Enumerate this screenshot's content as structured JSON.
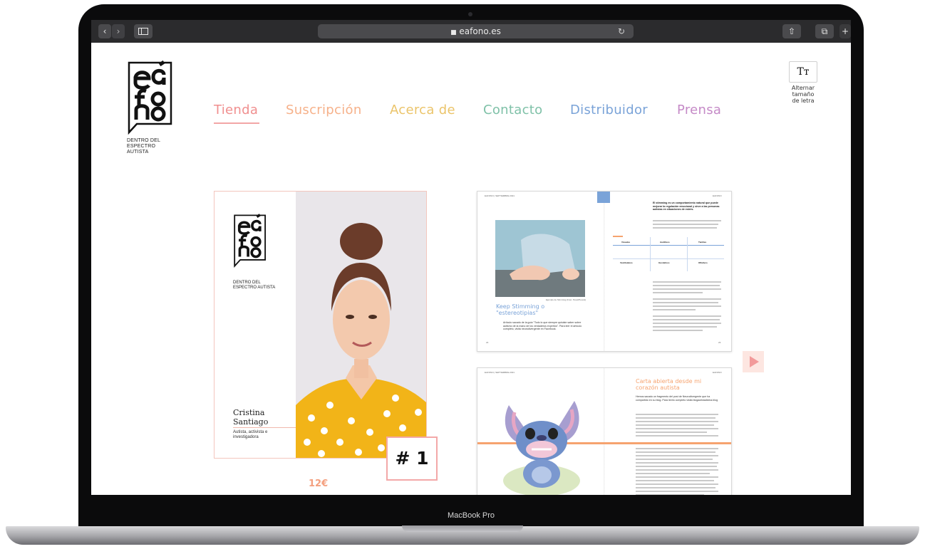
{
  "browser": {
    "url": "eafono.es",
    "back_glyph": "‹",
    "forward_glyph": "›",
    "reload_glyph": "↻",
    "share_glyph": "⇧",
    "tabs_glyph": "⧉",
    "newtab_glyph": "+"
  },
  "logo": {
    "subtitle": "DENTRO DEL ESPECTRO AUTISTA"
  },
  "nav": {
    "items": [
      {
        "label": "Tienda",
        "color": "#f08f8f"
      },
      {
        "label": "Suscripción",
        "color": "#f6b18a"
      },
      {
        "label": "Acerca de",
        "color": "#ebc46a"
      },
      {
        "label": "Contacto",
        "color": "#7fc1a8"
      },
      {
        "label": "Distribuidor",
        "color": "#7aa3d8"
      },
      {
        "label": "Prensa",
        "color": "#c58ac7"
      }
    ]
  },
  "font_toggle": {
    "button": "Tт",
    "label": "Alternar tamaño de letra"
  },
  "product": {
    "cover_logo_subtitle": "DENTRO DEL ESPECTRO AUTISTA",
    "cover_name": "Cristina Santiago",
    "cover_desc": "Autista, activista e investigadora",
    "issue": "# 1",
    "price": "12€"
  },
  "preview_1": {
    "header_left": "EAFONO | SEPTIEMBRE 2021",
    "header_right": "EAFONO",
    "caption": "Ejemplo de Stimming (Foto: Pexel/Pexels)",
    "title": "Keep Stimming o \"estereotipias\"",
    "intro": "Artículo sacado de la guía \"Todo lo que siempre quisiste saber sobre autismo de la mano de los verdaderos expertos\". Para leer el artículo completo, visita neurodivergente en Facebook.",
    "right_heading": "El stimming es un comportamiento natural que puede mejorar la regulación emocional y sirve a las personas autistas en situaciones de estrés.",
    "table_headers": [
      "Visuales",
      "Auditivos",
      "Táctiles"
    ],
    "table_headers_2": [
      "Vestibulares",
      "Gustativos",
      "Olfativos"
    ],
    "page_left": "22",
    "page_right": "23"
  },
  "preview_2": {
    "header_left": "EAFONO | SEPTIEMBRE 2021",
    "header_right": "EAFONO",
    "title": "Carta abierta desde mi corazón autista",
    "intro": "Hemos sacado un fragmento del post de Neurodivergente que ha compartido en su blog. Para leerlo completo visita blogautistadivina.blog"
  },
  "laptop_label": "MacBook Pro"
}
